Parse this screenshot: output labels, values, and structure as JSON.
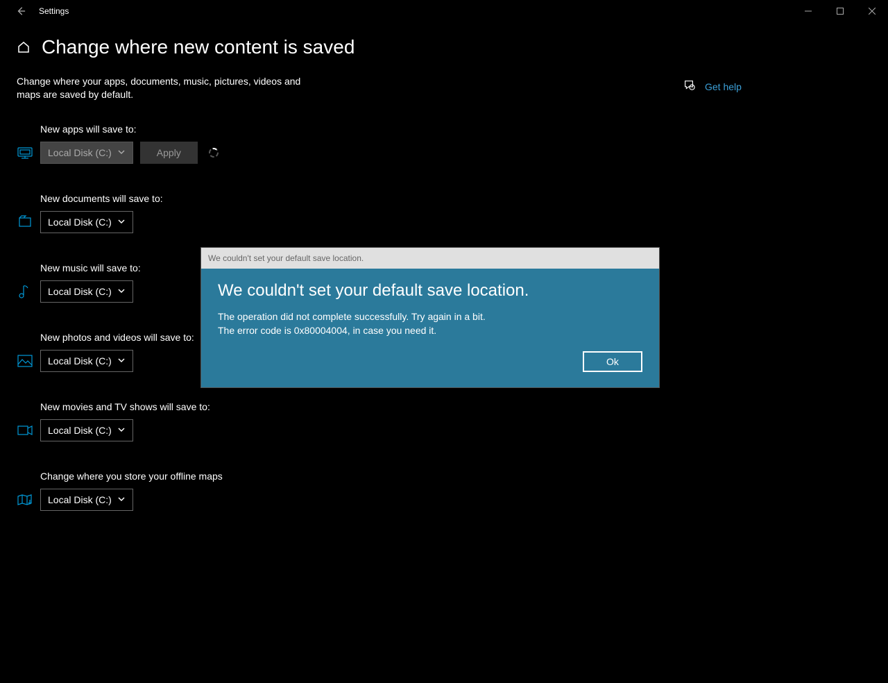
{
  "window": {
    "title": "Settings"
  },
  "page": {
    "title": "Change where new content is saved",
    "description": "Change where your apps, documents, music, pictures, videos and maps are saved by default."
  },
  "rows": {
    "apps": {
      "label": "New apps will save to:",
      "value": "Local Disk (C:)",
      "apply": "Apply"
    },
    "docs": {
      "label": "New documents will save to:",
      "value": "Local Disk (C:)"
    },
    "music": {
      "label": "New music will save to:",
      "value": "Local Disk (C:)"
    },
    "photos": {
      "label": "New photos and videos will save to:",
      "value": "Local Disk (C:)"
    },
    "movies": {
      "label": "New movies and TV shows will save to:",
      "value": "Local Disk (C:)"
    },
    "maps": {
      "label": "Change where you store your offline maps",
      "value": "Local Disk (C:)"
    }
  },
  "help": {
    "label": "Get help"
  },
  "dialog": {
    "titlebar": "We couldn't set your default save location.",
    "heading": "We couldn't set your default save location.",
    "line1": "The operation did not complete successfully. Try again in a bit.",
    "line2": "The error code is 0x80004004, in case you need it.",
    "ok": "Ok"
  }
}
